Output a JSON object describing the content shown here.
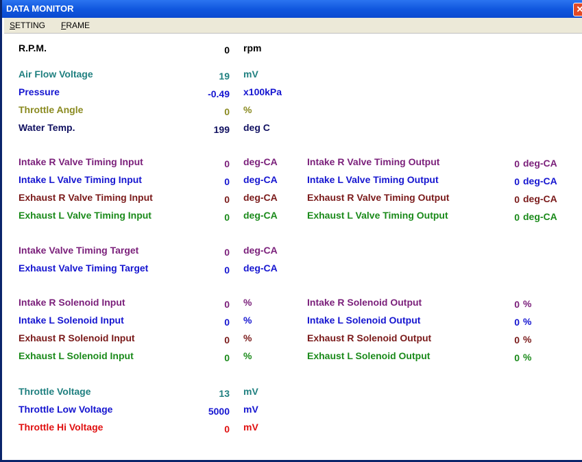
{
  "window": {
    "title": "DATA MONITOR",
    "close_glyph": "✕"
  },
  "menu": [
    "SETTING",
    "FRAME"
  ],
  "colors": {
    "titlebar": "#0f55dd",
    "menubar": "#ece9d8"
  },
  "left_rows": [
    {
      "label": "R.P.M.",
      "value": "0",
      "unit": "rpm",
      "color": "#000000"
    },
    {
      "label": "Air Flow Voltage",
      "value": "19",
      "unit": "mV",
      "color": "#208080"
    },
    {
      "label": "Pressure",
      "value": "-0.49",
      "unit": "x100kPa",
      "color": "#1515d0"
    },
    {
      "label": "Throttle Angle",
      "value": "0",
      "unit": "%",
      "color": "#8a8a20"
    },
    {
      "label": "Water Temp.",
      "value": "199",
      "unit": "deg C",
      "color": "#101060"
    },
    {
      "label": "Intake R Valve Timing Input",
      "value": "0",
      "unit": "deg-CA",
      "color": "#7a1f7a"
    },
    {
      "label": "Intake L Valve Timing Input",
      "value": "0",
      "unit": "deg-CA",
      "color": "#1515d0"
    },
    {
      "label": "Exhaust R Valve Timing Input",
      "value": "0",
      "unit": "deg-CA",
      "color": "#7a1a1a"
    },
    {
      "label": "Exhaust L Valve Timing Input",
      "value": "0",
      "unit": "deg-CA",
      "color": "#1a8a1a"
    },
    {
      "label": "Intake Valve Timing Target",
      "value": "0",
      "unit": "deg-CA",
      "color": "#7a1f7a"
    },
    {
      "label": "Exhaust Valve Timing Target",
      "value": "0",
      "unit": "deg-CA",
      "color": "#1515d0"
    },
    {
      "label": "Intake R Solenoid Input",
      "value": "0",
      "unit": "%",
      "color": "#7a1f7a"
    },
    {
      "label": "Intake L Solenoid Input",
      "value": "0",
      "unit": "%",
      "color": "#1515d0"
    },
    {
      "label": "Exhaust R Solenoid Input",
      "value": "0",
      "unit": "%",
      "color": "#7a1a1a"
    },
    {
      "label": "Exhaust L Solenoid Input",
      "value": "0",
      "unit": "%",
      "color": "#1a8a1a"
    },
    {
      "label": "Throttle Voltage",
      "value": "13",
      "unit": "mV",
      "color": "#208080"
    },
    {
      "label": "Throttle Low Voltage",
      "value": "5000",
      "unit": "mV",
      "color": "#1515d0"
    },
    {
      "label": "Throttle Hi Voltage",
      "value": "0",
      "unit": "mV",
      "color": "#e01010"
    }
  ],
  "right_rows": [
    {
      "label": "Intake R Valve Timing Output",
      "value": "0",
      "unit": "deg-CA",
      "color": "#7a1f7a"
    },
    {
      "label": "Intake L Valve Timing Output",
      "value": "0",
      "unit": "deg-CA",
      "color": "#1515d0"
    },
    {
      "label": "Exhaust R Valve Timing Output",
      "value": "0",
      "unit": "deg-CA",
      "color": "#7a1a1a"
    },
    {
      "label": "Exhaust L Valve Timing Output",
      "value": "0",
      "unit": "deg-CA",
      "color": "#1a8a1a"
    },
    {
      "label": "Intake R Solenoid Output",
      "value": "0",
      "unit": "%",
      "color": "#7a1f7a"
    },
    {
      "label": "Intake L Solenoid Output",
      "value": "0",
      "unit": "%",
      "color": "#1515d0"
    },
    {
      "label": "Exhaust R Solenoid Output",
      "value": "0",
      "unit": "%",
      "color": "#7a1a1a"
    },
    {
      "label": "Exhaust L Solenoid Output",
      "value": "0",
      "unit": "%",
      "color": "#1a8a1a"
    }
  ]
}
